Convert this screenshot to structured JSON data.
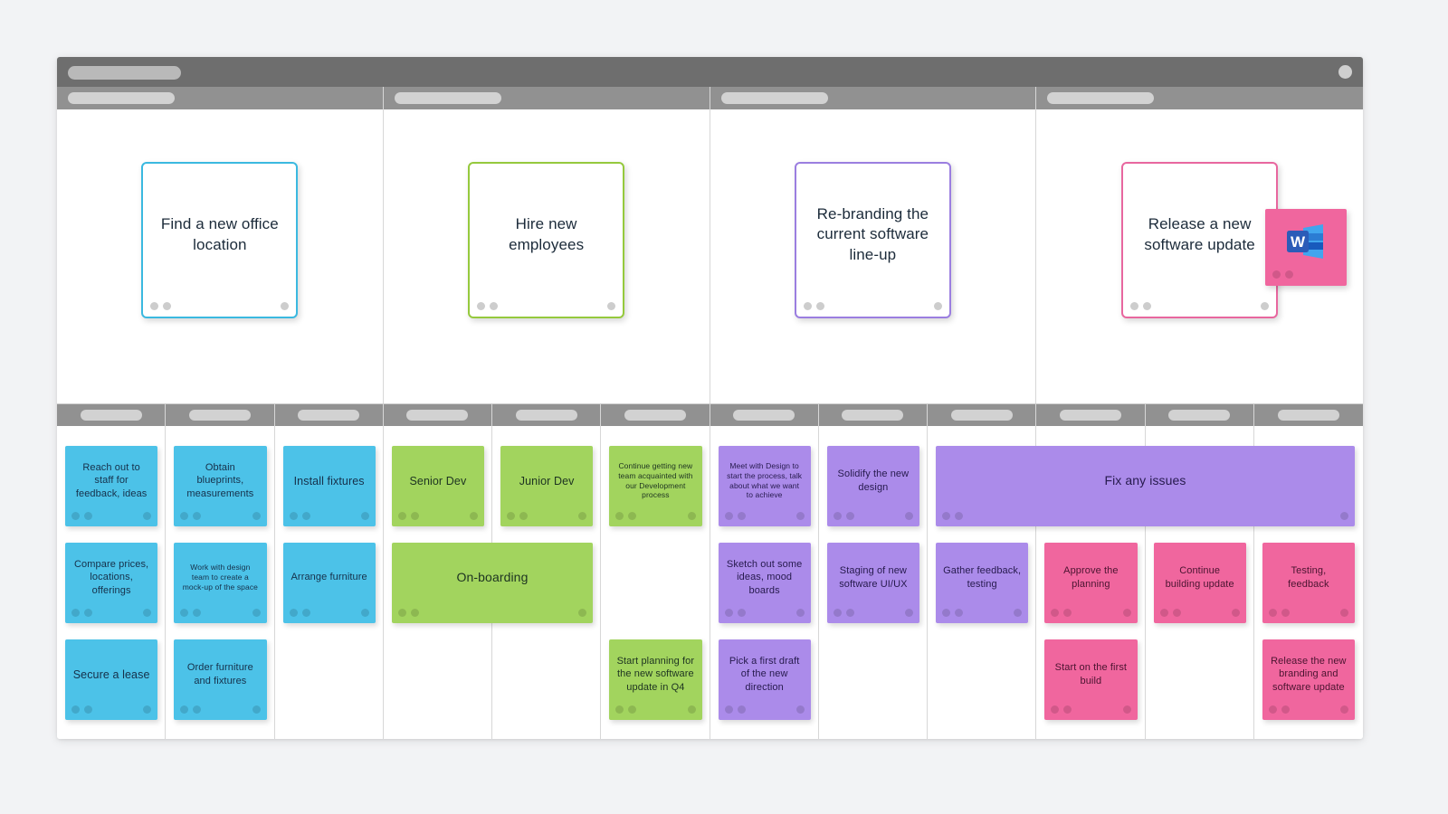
{
  "window": {
    "topbar_placeholder": "",
    "avatar": "user-avatar-dot"
  },
  "epics": [
    {
      "id": "epic-office",
      "title": "Find a new office location",
      "color": "#3bb9e0"
    },
    {
      "id": "epic-hiring",
      "title": "Hire new employees",
      "color": "#95c93d"
    },
    {
      "id": "epic-rebrand",
      "title": "Re-branding the current software line-up",
      "color": "#9b7ee0"
    },
    {
      "id": "epic-release",
      "title": "Release a new software update",
      "color": "#e8679f"
    }
  ],
  "floating_sticky": {
    "icon": "microsoft-word-icon",
    "color": "#f0669e",
    "label": ""
  },
  "columns": [
    {
      "index": 1,
      "label": ""
    },
    {
      "index": 2,
      "label": ""
    },
    {
      "index": 3,
      "label": ""
    },
    {
      "index": 4,
      "label": ""
    },
    {
      "index": 5,
      "label": ""
    },
    {
      "index": 6,
      "label": ""
    },
    {
      "index": 7,
      "label": ""
    },
    {
      "index": 8,
      "label": ""
    },
    {
      "index": 9,
      "label": ""
    },
    {
      "index": 10,
      "label": ""
    },
    {
      "index": 11,
      "label": ""
    },
    {
      "index": 12,
      "label": ""
    }
  ],
  "cards": [
    {
      "id": "c1",
      "text": "Reach out to staff for feedback, ideas",
      "color": "blue",
      "col": 1,
      "span": 1,
      "row": 1,
      "size": "s"
    },
    {
      "id": "c2",
      "text": "Obtain blueprints, measurements",
      "color": "blue",
      "col": 2,
      "span": 1,
      "row": 1,
      "size": "s"
    },
    {
      "id": "c3",
      "text": "Install fixtures",
      "color": "blue",
      "col": 3,
      "span": 1,
      "row": 1,
      "size": "m"
    },
    {
      "id": "c4",
      "text": "Senior Dev",
      "color": "green",
      "col": 4,
      "span": 1,
      "row": 1,
      "size": "m"
    },
    {
      "id": "c5",
      "text": "Junior Dev",
      "color": "green",
      "col": 5,
      "span": 1,
      "row": 1,
      "size": "m"
    },
    {
      "id": "c6",
      "text": "Continue getting new team acquainted with our Development process",
      "color": "green",
      "col": 6,
      "span": 1,
      "row": 1,
      "size": "xs"
    },
    {
      "id": "c7",
      "text": "Meet with Design to start the process, talk about what we want to achieve",
      "color": "purple",
      "col": 7,
      "span": 1,
      "row": 1,
      "size": "xs"
    },
    {
      "id": "c8",
      "text": "Solidify the new design",
      "color": "purple",
      "col": 8,
      "span": 1,
      "row": 1,
      "size": "s"
    },
    {
      "id": "c9",
      "text": "Fix any issues",
      "color": "purple",
      "col": 9,
      "span": 4,
      "row": 1,
      "size": "m"
    },
    {
      "id": "c10",
      "text": "Compare prices, locations, offerings",
      "color": "blue",
      "col": 1,
      "span": 1,
      "row": 2,
      "size": "s"
    },
    {
      "id": "c11",
      "text": "Work with design team to create a mock-up of the space",
      "color": "blue",
      "col": 2,
      "span": 1,
      "row": 2,
      "size": "xs"
    },
    {
      "id": "c12",
      "text": "Arrange furniture",
      "color": "blue",
      "col": 3,
      "span": 1,
      "row": 2,
      "size": "s"
    },
    {
      "id": "c13",
      "text": "On-boarding",
      "color": "green",
      "col": 4,
      "span": 2,
      "row": 2,
      "size": "m"
    },
    {
      "id": "c14",
      "text": "Sketch out some ideas, mood boards",
      "color": "purple",
      "col": 7,
      "span": 1,
      "row": 2,
      "size": "s"
    },
    {
      "id": "c15",
      "text": "Staging of new software UI/UX",
      "color": "purple",
      "col": 8,
      "span": 1,
      "row": 2,
      "size": "s"
    },
    {
      "id": "c16",
      "text": "Gather feedback, testing",
      "color": "purple",
      "col": 9,
      "span": 1,
      "row": 2,
      "size": "s"
    },
    {
      "id": "c17",
      "text": "Approve the planning",
      "color": "pink",
      "col": 10,
      "span": 1,
      "row": 2,
      "size": "s"
    },
    {
      "id": "c18",
      "text": "Continue building update",
      "color": "pink",
      "col": 11,
      "span": 1,
      "row": 2,
      "size": "s"
    },
    {
      "id": "c19",
      "text": "Testing, feedback",
      "color": "pink",
      "col": 12,
      "span": 1,
      "row": 2,
      "size": "s"
    },
    {
      "id": "c20",
      "text": "Secure a lease",
      "color": "blue",
      "col": 1,
      "span": 1,
      "row": 3,
      "size": "m"
    },
    {
      "id": "c21",
      "text": "Order furniture and fixtures",
      "color": "blue",
      "col": 2,
      "span": 1,
      "row": 3,
      "size": "s"
    },
    {
      "id": "c22",
      "text": "Start planning for the new software update in Q4",
      "color": "green",
      "col": 6,
      "span": 1,
      "row": 3,
      "size": "s"
    },
    {
      "id": "c23",
      "text": "Pick a first draft of the new direction",
      "color": "purple",
      "col": 7,
      "span": 1,
      "row": 3,
      "size": "s"
    },
    {
      "id": "c24",
      "text": "Start on the first build",
      "color": "pink",
      "col": 10,
      "span": 1,
      "row": 3,
      "size": "s"
    },
    {
      "id": "c25",
      "text": "Release the new branding and software update",
      "color": "pink",
      "col": 12,
      "span": 1,
      "row": 3,
      "size": "s"
    }
  ],
  "palette": {
    "blue": "#4cc2e8",
    "green": "#a2d45e",
    "purple": "#ab8bea",
    "pink": "#f0669e",
    "chrome_dark": "#6e6e6e",
    "chrome_mid": "#919191",
    "page_bg": "#f2f3f5"
  }
}
